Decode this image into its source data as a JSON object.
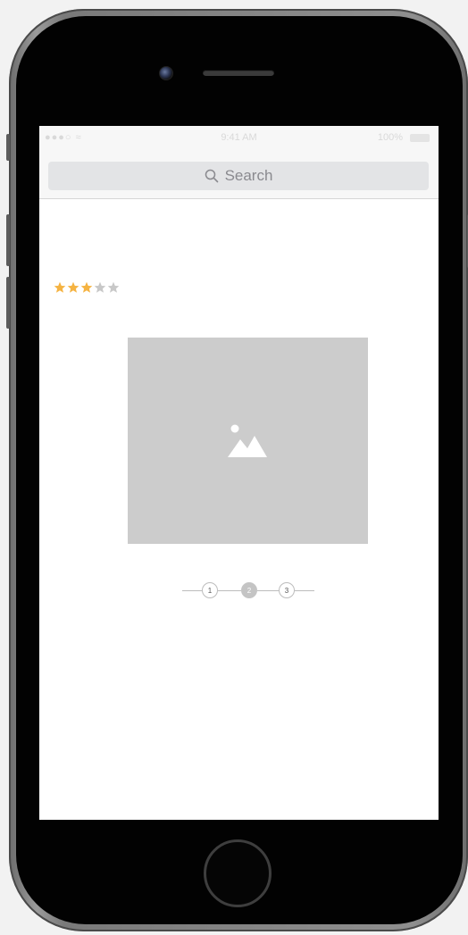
{
  "status_bar": {
    "signal": "●●●○ ≈",
    "time": "9:41 AM",
    "battery_text": "100%"
  },
  "search": {
    "placeholder": "Search"
  },
  "rating": {
    "value": 3,
    "max": 5,
    "filled_color": "#f5b342",
    "empty_color": "#c8c8c8"
  },
  "image_placeholder": {
    "icon": "image-icon",
    "background": "#cccccc"
  },
  "stepper": {
    "steps": [
      "1",
      "2",
      "3"
    ],
    "active_index": 1
  },
  "device": {
    "home_button_icon": "home-button",
    "camera_icon": "camera-icon"
  }
}
